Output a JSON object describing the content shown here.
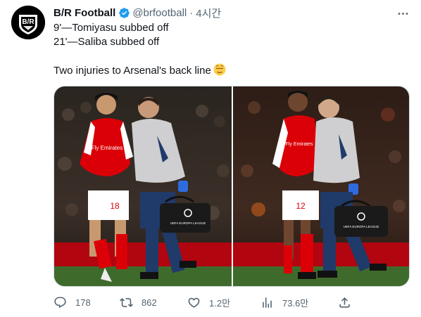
{
  "author": {
    "name": "B/R Football",
    "handle": "@brfootball",
    "separator": "·",
    "time": "4시간",
    "avatar_text": "B/R"
  },
  "tweet": {
    "line1": "9'—Tomiyasu subbed off",
    "line2": "21'—Saliba subbed off",
    "line3": "Two injuries to Arsenal's back line",
    "emoji": "relieved-face"
  },
  "media": {
    "left_photo": {
      "shirt_number": "18",
      "sponsor": "Fly Emirates",
      "bag_text": "UEFA EUROPA LEAGUE"
    },
    "right_photo": {
      "shirt_number": "12",
      "sponsor": "Fly Emirates",
      "bag_text": "UEFA EUROPA LEAGUE"
    }
  },
  "actions": {
    "replies": "178",
    "retweets": "862",
    "likes": "1.2만",
    "views": "73.6만"
  },
  "colors": {
    "text": "#0f1419",
    "muted": "#536471",
    "verified": "#1d9bf0",
    "arsenal_red": "#db0007"
  },
  "icons": [
    "verified-badge-icon",
    "more-icon",
    "reply-icon",
    "retweet-icon",
    "like-icon",
    "views-icon",
    "share-icon"
  ]
}
